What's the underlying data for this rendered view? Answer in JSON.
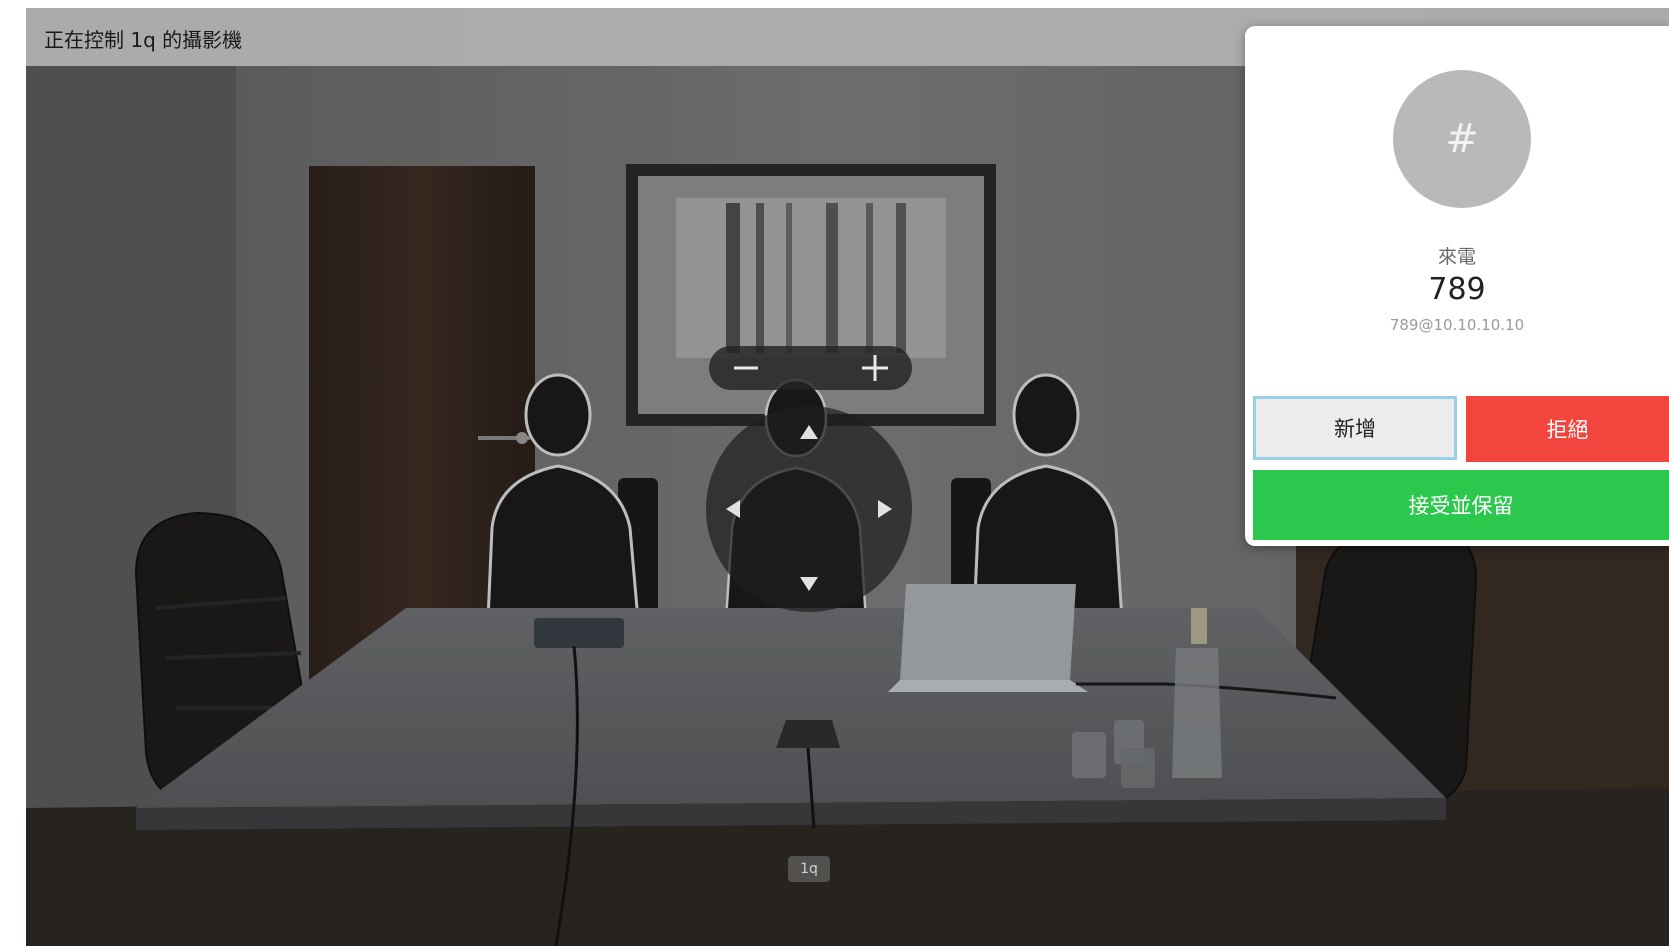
{
  "header": {
    "title": "正在控制 1q 的攝影機"
  },
  "camera_controls": {
    "zoom_out_icon": "minus-icon",
    "zoom_in_icon": "plus-icon",
    "pan_up_icon": "triangle-up-icon",
    "pan_down_icon": "triangle-down-icon",
    "pan_left_icon": "triangle-left-icon",
    "pan_right_icon": "triangle-right-icon",
    "camera_label": "1q"
  },
  "incoming_call": {
    "avatar_symbol": "#",
    "status": "來電",
    "number": "789",
    "address": "789@10.10.10.10",
    "add_label": "新增",
    "decline_label": "拒絕",
    "accept_hold_label": "接受並保留",
    "colors": {
      "decline": "#f2453d",
      "accept": "#2cc84d",
      "focus_border": "#9ad0e6"
    }
  }
}
